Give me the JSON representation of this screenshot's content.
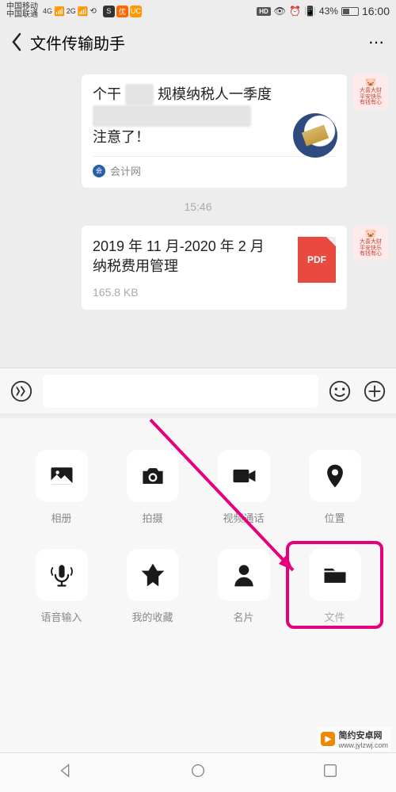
{
  "status": {
    "carrier1": "中国移动",
    "carrier2": "中国联通",
    "net1": "4G",
    "net2": "2G",
    "hd": "HD",
    "battery": "43%",
    "time": "16:00"
  },
  "header": {
    "title": "文件传输助手",
    "more": "⋯"
  },
  "chat": {
    "msg1": {
      "line1_a": "个干",
      "line1_blur": "占用",
      "line1_b": "规模纳税人一季度",
      "line2_blur": "培训 税务申报 的",
      "line3": "注意了！",
      "source": "会计网"
    },
    "time": "15:46",
    "msg2": {
      "title": "2019 年 11 月-2020 年 2 月",
      "blur": "纳税费用管理",
      "size": "165.8 KB",
      "pdf": "PDF"
    }
  },
  "panel": {
    "items": [
      {
        "label": "相册",
        "icon": "album"
      },
      {
        "label": "拍摄",
        "icon": "camera"
      },
      {
        "label": "视频通话",
        "icon": "video"
      },
      {
        "label": "位置",
        "icon": "location"
      },
      {
        "label": "语音输入",
        "icon": "voice"
      },
      {
        "label": "我的收藏",
        "icon": "fav"
      },
      {
        "label": "名片",
        "icon": "card"
      },
      {
        "label": "文件",
        "icon": "file"
      }
    ]
  },
  "watermark": {
    "title": "简约安卓网",
    "site": "www.jylzwj.com"
  },
  "avatar": {
    "l1": "大喜大财",
    "l2": "平安快乐",
    "l3": "有钱有心"
  }
}
